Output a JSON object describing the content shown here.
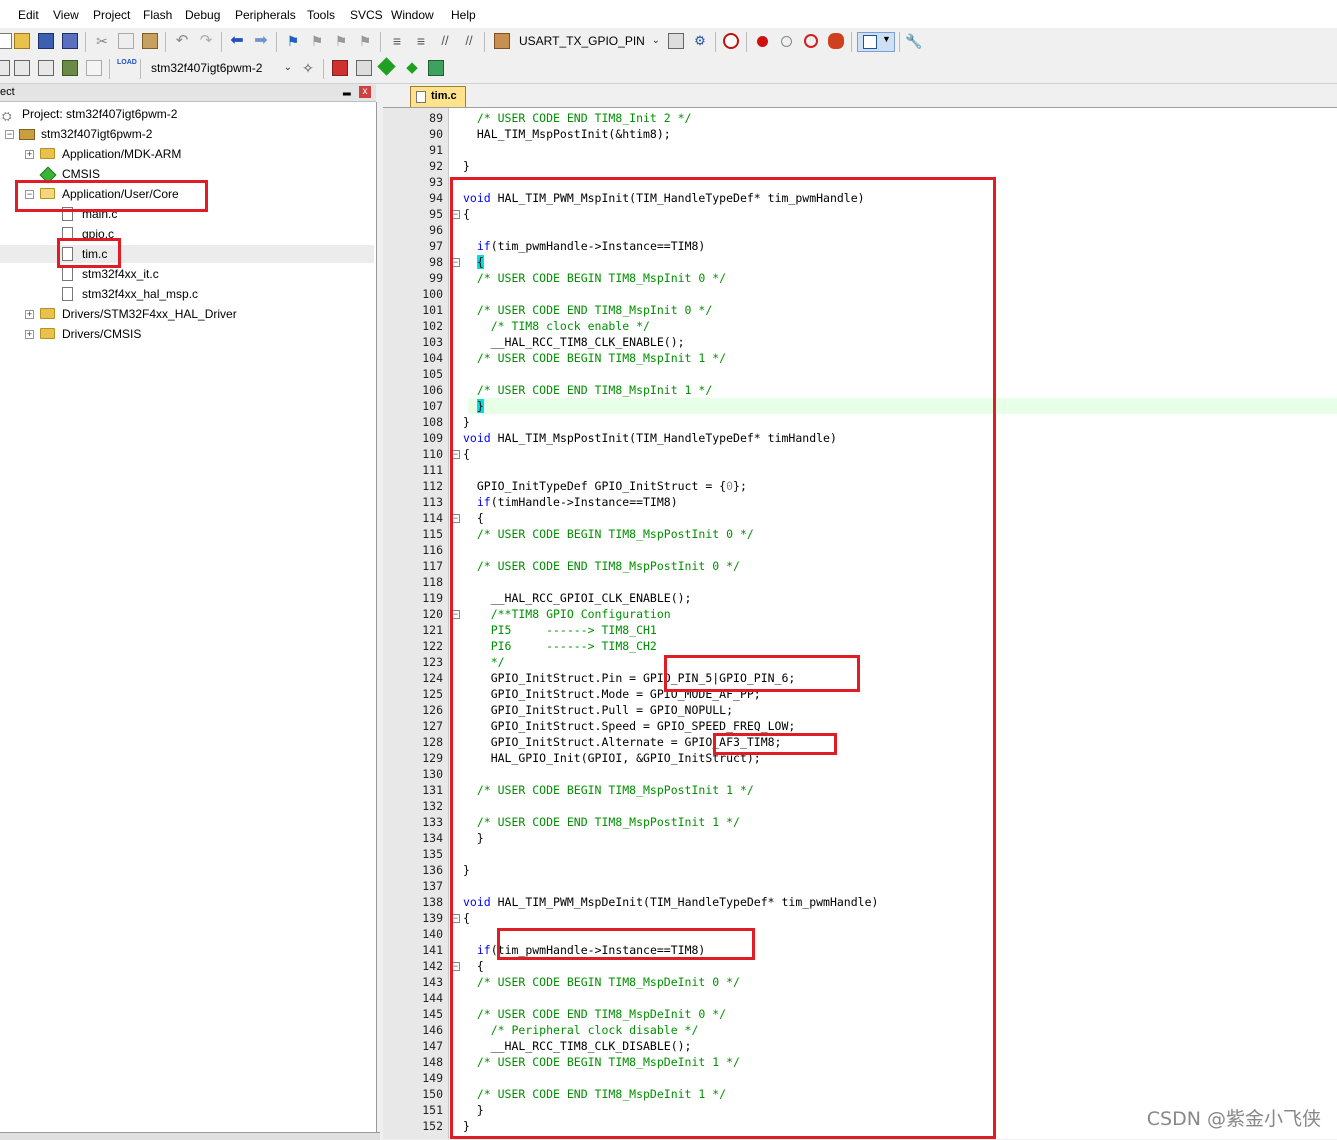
{
  "menu": [
    "Edit",
    "View",
    "Project",
    "Flash",
    "Debug",
    "Peripherals",
    "Tools",
    "SVCS",
    "Window",
    "Help"
  ],
  "toolbar": {
    "target_combo": "USART_TX_GPIO_PIN",
    "project_combo": "stm32f407igt6pwm-2",
    "load_label": "LOAD"
  },
  "project_panel": {
    "title": "ect",
    "pin": "▂",
    "close": "x",
    "project_root": "Project: stm32f407igt6pwm-2",
    "target": "stm32f407igt6pwm-2",
    "groups": [
      {
        "label": "Application/MDK-ARM"
      },
      {
        "label": "CMSIS"
      },
      {
        "label": "Application/User/Core"
      },
      {
        "label": "Drivers/STM32F4xx_HAL_Driver"
      },
      {
        "label": "Drivers/CMSIS"
      }
    ],
    "files": [
      "main.c",
      "gpio.c",
      "tim.c",
      "stm32f4xx_it.c",
      "stm32f4xx_hal_msp.c"
    ]
  },
  "editor": {
    "tab": "tim.c",
    "lines": [
      {
        "n": "89",
        "t": "  /* USER CODE END TIM8_Init 2 */"
      },
      {
        "n": "90",
        "t": "  HAL_TIM_MspPostInit(&htim8);"
      },
      {
        "n": "91",
        "t": ""
      },
      {
        "n": "92",
        "t": "}"
      },
      {
        "n": "93",
        "t": ""
      },
      {
        "n": "94",
        "t": "void HAL_TIM_PWM_MspInit(TIM_HandleTypeDef* tim_pwmHandle)"
      },
      {
        "n": "95",
        "t": "{"
      },
      {
        "n": "96",
        "t": ""
      },
      {
        "n": "97",
        "t": "  if(tim_pwmHandle->Instance==TIM8)"
      },
      {
        "n": "98",
        "t": "  {"
      },
      {
        "n": "99",
        "t": "  /* USER CODE BEGIN TIM8_MspInit 0 */"
      },
      {
        "n": "100",
        "t": ""
      },
      {
        "n": "101",
        "t": "  /* USER CODE END TIM8_MspInit 0 */"
      },
      {
        "n": "102",
        "t": "    /* TIM8 clock enable */"
      },
      {
        "n": "103",
        "t": "    __HAL_RCC_TIM8_CLK_ENABLE();"
      },
      {
        "n": "104",
        "t": "  /* USER CODE BEGIN TIM8_MspInit 1 */"
      },
      {
        "n": "105",
        "t": ""
      },
      {
        "n": "106",
        "t": "  /* USER CODE END TIM8_MspInit 1 */"
      },
      {
        "n": "107",
        "t": "  }"
      },
      {
        "n": "108",
        "t": "}"
      },
      {
        "n": "109",
        "t": "void HAL_TIM_MspPostInit(TIM_HandleTypeDef* timHandle)"
      },
      {
        "n": "110",
        "t": "{"
      },
      {
        "n": "111",
        "t": ""
      },
      {
        "n": "112",
        "t": "  GPIO_InitTypeDef GPIO_InitStruct = {0};"
      },
      {
        "n": "113",
        "t": "  if(timHandle->Instance==TIM8)"
      },
      {
        "n": "114",
        "t": "  {"
      },
      {
        "n": "115",
        "t": "  /* USER CODE BEGIN TIM8_MspPostInit 0 */"
      },
      {
        "n": "116",
        "t": ""
      },
      {
        "n": "117",
        "t": "  /* USER CODE END TIM8_MspPostInit 0 */"
      },
      {
        "n": "118",
        "t": ""
      },
      {
        "n": "119",
        "t": "    __HAL_RCC_GPIOI_CLK_ENABLE();"
      },
      {
        "n": "120",
        "t": "    /**TIM8 GPIO Configuration"
      },
      {
        "n": "121",
        "t": "    PI5     ------> TIM8_CH1"
      },
      {
        "n": "122",
        "t": "    PI6     ------> TIM8_CH2"
      },
      {
        "n": "123",
        "t": "    */"
      },
      {
        "n": "124",
        "t": "    GPIO_InitStruct.Pin = GPIO_PIN_5|GPIO_PIN_6;"
      },
      {
        "n": "125",
        "t": "    GPIO_InitStruct.Mode = GPIO_MODE_AF_PP;"
      },
      {
        "n": "126",
        "t": "    GPIO_InitStruct.Pull = GPIO_NOPULL;"
      },
      {
        "n": "127",
        "t": "    GPIO_InitStruct.Speed = GPIO_SPEED_FREQ_LOW;"
      },
      {
        "n": "128",
        "t": "    GPIO_InitStruct.Alternate = GPIO_AF3_TIM8;"
      },
      {
        "n": "129",
        "t": "    HAL_GPIO_Init(GPIOI, &GPIO_InitStruct);"
      },
      {
        "n": "130",
        "t": ""
      },
      {
        "n": "131",
        "t": "  /* USER CODE BEGIN TIM8_MspPostInit 1 */"
      },
      {
        "n": "132",
        "t": ""
      },
      {
        "n": "133",
        "t": "  /* USER CODE END TIM8_MspPostInit 1 */"
      },
      {
        "n": "134",
        "t": "  }"
      },
      {
        "n": "135",
        "t": ""
      },
      {
        "n": "136",
        "t": "}"
      },
      {
        "n": "137",
        "t": ""
      },
      {
        "n": "138",
        "t": "void HAL_TIM_PWM_MspDeInit(TIM_HandleTypeDef* tim_pwmHandle)"
      },
      {
        "n": "139",
        "t": "{"
      },
      {
        "n": "140",
        "t": ""
      },
      {
        "n": "141",
        "t": "  if(tim_pwmHandle->Instance==TIM8)"
      },
      {
        "n": "142",
        "t": "  {"
      },
      {
        "n": "143",
        "t": "  /* USER CODE BEGIN TIM8_MspDeInit 0 */"
      },
      {
        "n": "144",
        "t": ""
      },
      {
        "n": "145",
        "t": "  /* USER CODE END TIM8_MspDeInit 0 */"
      },
      {
        "n": "146",
        "t": "    /* Peripheral clock disable */"
      },
      {
        "n": "147",
        "t": "    __HAL_RCC_TIM8_CLK_DISABLE();"
      },
      {
        "n": "148",
        "t": "  /* USER CODE BEGIN TIM8_MspDeInit 1 */"
      },
      {
        "n": "149",
        "t": ""
      },
      {
        "n": "150",
        "t": "  /* USER CODE END TIM8_MspDeInit 1 */"
      },
      {
        "n": "151",
        "t": "  }"
      },
      {
        "n": "152",
        "t": "}"
      }
    ]
  },
  "watermark": "CSDN @紫金小飞侠"
}
